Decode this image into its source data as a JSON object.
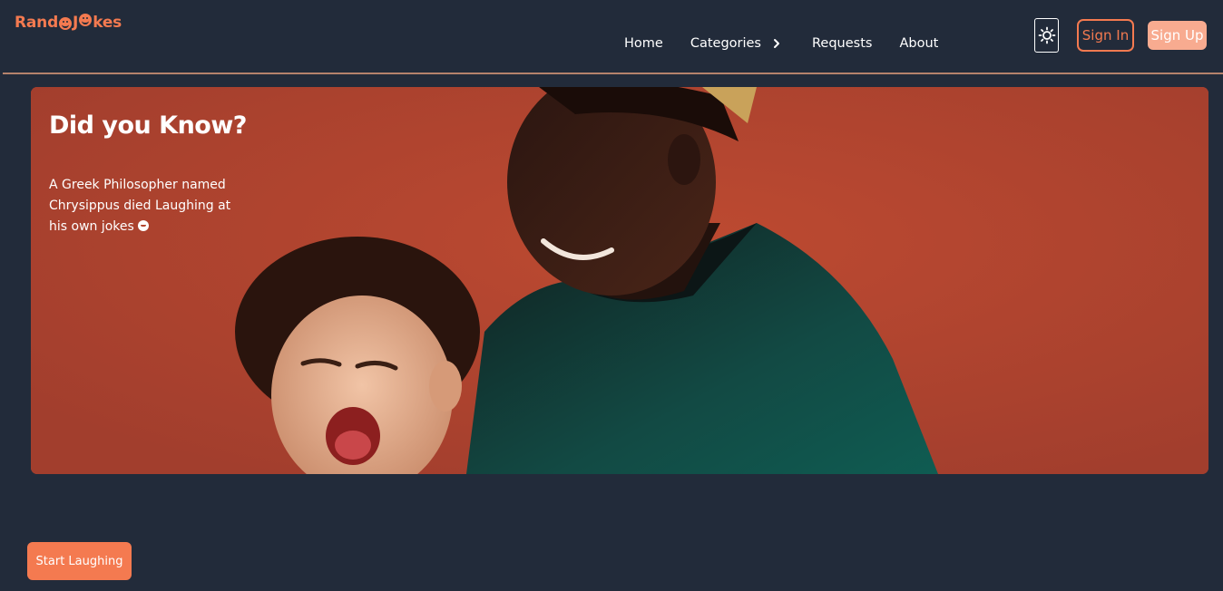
{
  "header": {
    "logo": {
      "part1": "Rand",
      "part2": "J",
      "part3": "kes"
    },
    "nav": {
      "home": "Home",
      "categories": "Categories",
      "requests": "Requests",
      "about": "About"
    },
    "theme_toggle_icon": "sun-icon",
    "sign_in": "Sign In",
    "sign_up": "Sign Up"
  },
  "hero": {
    "title": "Did you Know?",
    "fact": "A Greek Philosopher named Chrysippus died Laughing at his own jokes",
    "fact_icon": "smiley-icon"
  },
  "cta": {
    "start_label": "Start Laughing"
  },
  "colors": {
    "background": "#222b3a",
    "accent": "#f47a50",
    "accent_light": "#f8ab90",
    "hero_wall": "#b2452f"
  }
}
